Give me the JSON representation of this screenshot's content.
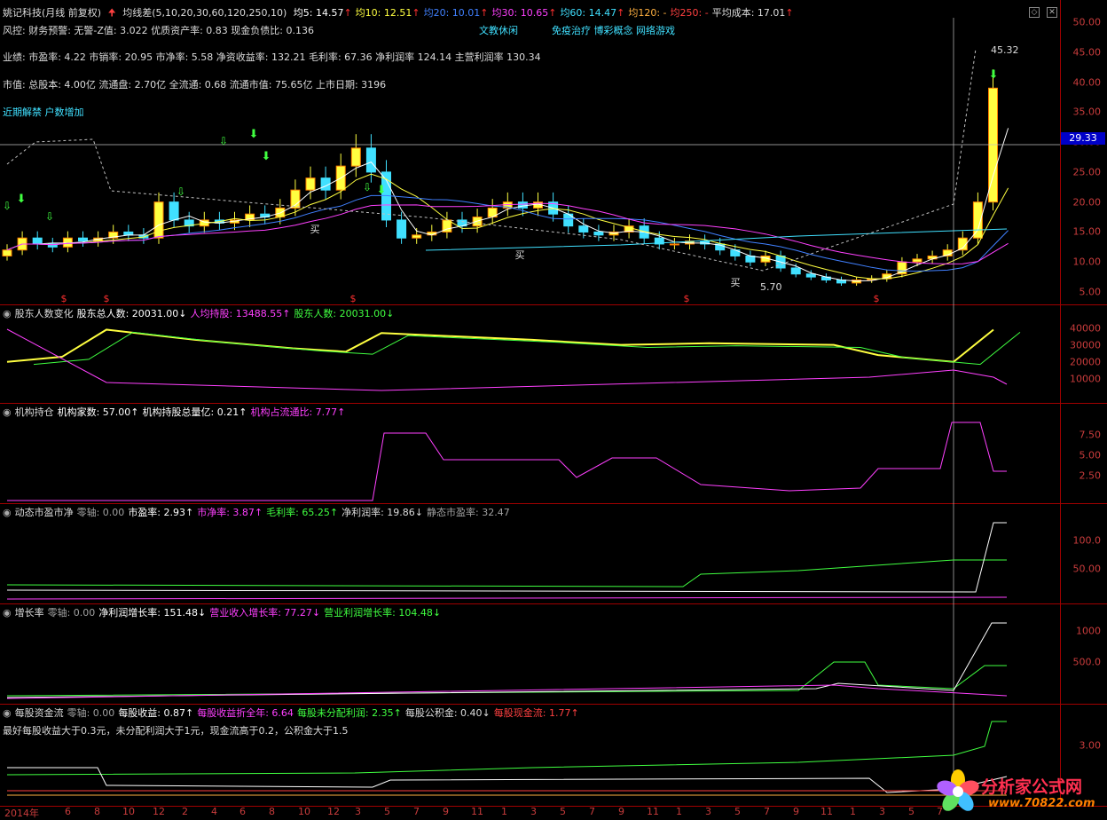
{
  "header": {
    "stock": "姚记科技(月线 前复权)",
    "ma_name": "均线差(5,10,20,30,60,120,250,10)",
    "ma_items": [
      {
        "label": "均5:",
        "value": "14.57",
        "color": "#ffffff",
        "dir": "↑"
      },
      {
        "label": "均10:",
        "value": "12.51",
        "color": "#ffff40",
        "dir": "↑"
      },
      {
        "label": "均20:",
        "value": "10.01",
        "color": "#4080ff",
        "dir": "↑"
      },
      {
        "label": "均30:",
        "value": "10.65",
        "color": "#ff40ff",
        "dir": "↑"
      },
      {
        "label": "均60:",
        "value": "14.47",
        "color": "#40e0ff",
        "dir": "↑"
      },
      {
        "label": "均120:",
        "value": "-",
        "color": "#ffb040",
        "dir": ""
      },
      {
        "label": "均250:",
        "value": "-",
        "color": "#ff4040",
        "dir": ""
      },
      {
        "label": "平均成本:",
        "value": "17.01",
        "color": "#dcdcdc",
        "dir": "↑"
      }
    ]
  },
  "info_lines": {
    "risk": "风控: 财务预警: 无警-Z值: 3.022 优质资产率: 0.83 现金负债比: 0.136",
    "concept": "文教休闲",
    "concept2": "免疫治疗 博彩概念 网络游戏",
    "perf": "业绩: 市盈率: 4.22 市销率: 20.95 市净率: 5.58 净资收益率: 132.21 毛利率: 67.36 净利润率 124.14 主营利润率 130.34",
    "market": "市值: 总股本: 4.00亿 流通盘: 2.70亿 全流通: 0.68 流通市值: 75.65亿 上市日期: 3196",
    "recent": "近期解禁 户数增加"
  },
  "main_chart": {
    "ylim": [
      3.5,
      52.5
    ],
    "ticks": [
      "50.00",
      "45.00",
      "40.00",
      "35.00",
      "30.00",
      "25.00",
      "20.00",
      "15.00",
      "10.00",
      "5.00"
    ],
    "current_price": "29.33",
    "high_label": "45.32",
    "low_label": "5.70",
    "buy_label": "买"
  },
  "panels": [
    {
      "id": "holders",
      "items": [
        {
          "text": "股东人数变化",
          "color": "#dcdcdc"
        },
        {
          "text": "股东总人数: 20031.00↓",
          "color": "#ffffff"
        },
        {
          "text": "人均持股: 13488.55↑",
          "color": "#ff40ff"
        },
        {
          "text": "股东人数: 20031.00↓",
          "color": "#40ff40"
        }
      ],
      "ticks": [
        "40000",
        "30000",
        "20000",
        "10000"
      ]
    },
    {
      "id": "inst",
      "items": [
        {
          "text": "机构持仓",
          "color": "#dcdcdc"
        },
        {
          "text": "机构家数: 57.00↑",
          "color": "#ffffff"
        },
        {
          "text": "机构持股总量亿: 0.21↑",
          "color": "#ffffff"
        },
        {
          "text": "机构占流通比: 7.77↑",
          "color": "#ff40ff"
        }
      ],
      "ticks": [
        "7.50",
        "5.00",
        "2.50"
      ]
    },
    {
      "id": "pe",
      "items": [
        {
          "text": "动态市盈市净",
          "color": "#dcdcdc"
        },
        {
          "text": "零轴: 0.00",
          "color": "#a0a0a0"
        },
        {
          "text": "市盈率: 2.93↑",
          "color": "#ffffff"
        },
        {
          "text": "市净率: 3.87↑",
          "color": "#ff40ff"
        },
        {
          "text": "毛利率: 65.25↑",
          "color": "#40ff40"
        },
        {
          "text": "净利润率: 19.86↓",
          "color": "#dcdcdc"
        },
        {
          "text": "静态市盈率: 32.47",
          "color": "#a0a0a0"
        }
      ],
      "ticks": [
        "100.0",
        "50.00"
      ]
    },
    {
      "id": "growth",
      "items": [
        {
          "text": "增长率",
          "color": "#dcdcdc"
        },
        {
          "text": "零轴: 0.00",
          "color": "#a0a0a0"
        },
        {
          "text": "净利润增长率: 151.48↓",
          "color": "#ffffff"
        },
        {
          "text": "营业收入增长率: 77.27↓",
          "color": "#ff40ff"
        },
        {
          "text": "营业利润增长率: 104.48↓",
          "color": "#40ff40"
        }
      ],
      "ticks": [
        "1000",
        "500.0"
      ]
    },
    {
      "id": "eps",
      "items": [
        {
          "text": "每股资金流",
          "color": "#dcdcdc"
        },
        {
          "text": "零轴: 0.00",
          "color": "#a0a0a0"
        },
        {
          "text": "每股收益: 0.87↑",
          "color": "#ffffff"
        },
        {
          "text": "每股收益折全年: 6.64",
          "color": "#ff40ff"
        },
        {
          "text": "每股未分配利润: 2.35↑",
          "color": "#40ff40"
        },
        {
          "text": "每股公积金: 0.40↓",
          "color": "#dcdcdc"
        },
        {
          "text": "每股现金流: 1.77↑",
          "color": "#ff4040"
        }
      ],
      "note": "最好每股收益大于0.3元，未分配利润大于1元，现金流高于0.2，公积金大于1.5",
      "ticks": [
        "3.00"
      ]
    }
  ],
  "x_axis": [
    "2014年",
    "6",
    "8",
    "10",
    "12",
    "2",
    "4",
    "6",
    "8",
    "10",
    "12",
    "3",
    "5",
    "7",
    "9",
    "11",
    "1",
    "3",
    "5",
    "7",
    "9",
    "11",
    "1",
    "3",
    "5",
    "7",
    "9",
    "11",
    "1",
    "3",
    "5",
    "7"
  ],
  "watermark": {
    "cn": "分析家公式网",
    "url": "www.70822.com"
  },
  "colors": {
    "up": "#ffff40",
    "down": "#40e0ff",
    "grid_red": "#a00000"
  }
}
